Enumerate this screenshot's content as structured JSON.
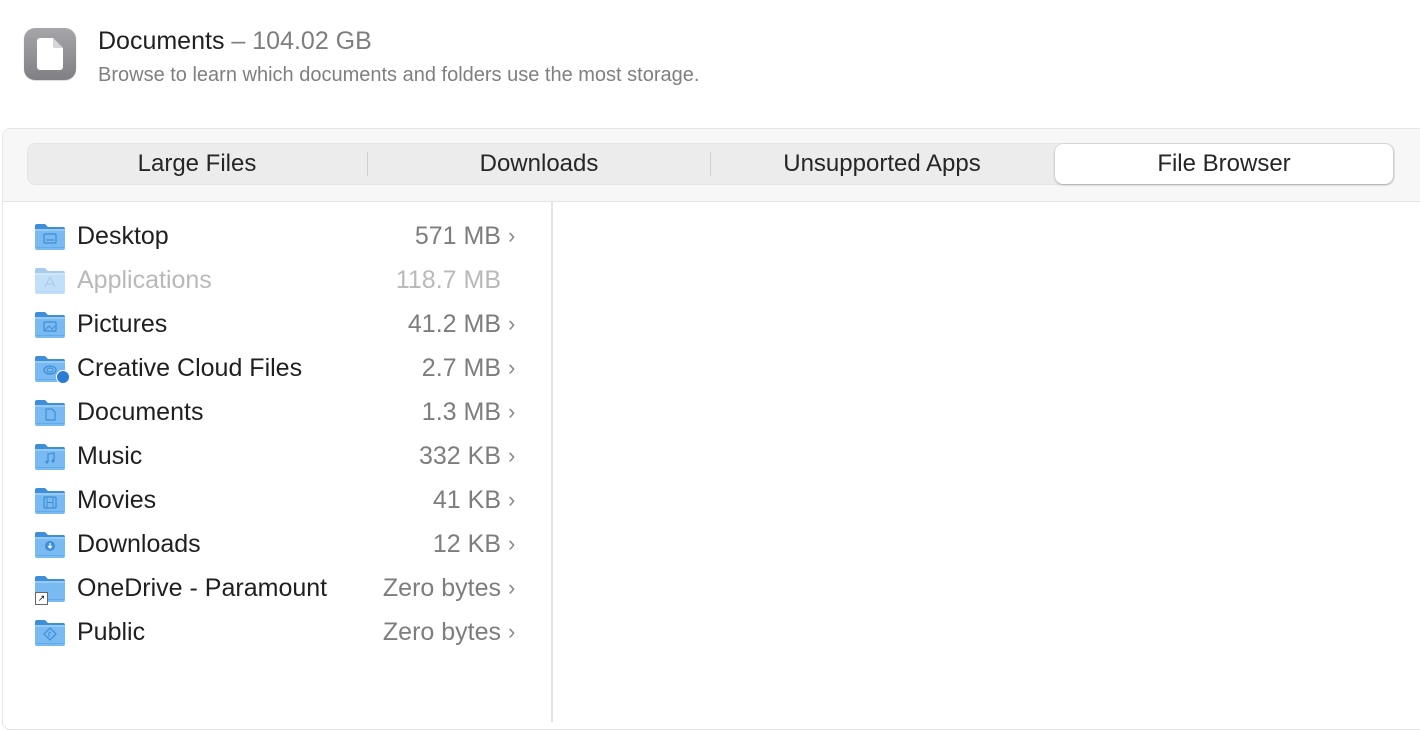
{
  "header": {
    "icon": "document-icon",
    "title": "Documents",
    "separator": "–",
    "size": "104.02 GB",
    "subtitle": "Browse to learn which documents and folders use the most storage."
  },
  "tabs": [
    {
      "label": "Large Files",
      "active": false
    },
    {
      "label": "Downloads",
      "active": false
    },
    {
      "label": "Unsupported Apps",
      "active": false
    },
    {
      "label": "File Browser",
      "active": true
    }
  ],
  "folders": [
    {
      "name": "Desktop",
      "size": "571 MB",
      "icon": "desktop-folder-icon",
      "glyph": "desktop",
      "enabled": true,
      "has_chevron": true
    },
    {
      "name": "Applications",
      "size": "118.7 MB",
      "icon": "applications-folder-icon",
      "glyph": "apps",
      "enabled": false,
      "has_chevron": false
    },
    {
      "name": "Pictures",
      "size": "41.2 MB",
      "icon": "pictures-folder-icon",
      "glyph": "pictures",
      "enabled": true,
      "has_chevron": true
    },
    {
      "name": "Creative Cloud Files",
      "size": "2.7 MB",
      "icon": "creative-cloud-folder-icon",
      "glyph": "cc",
      "enabled": true,
      "has_chevron": true,
      "badge": "sync-paused-badge"
    },
    {
      "name": "Documents",
      "size": "1.3 MB",
      "icon": "documents-folder-icon",
      "glyph": "document",
      "enabled": true,
      "has_chevron": true
    },
    {
      "name": "Music",
      "size": "332 KB",
      "icon": "music-folder-icon",
      "glyph": "music",
      "enabled": true,
      "has_chevron": true
    },
    {
      "name": "Movies",
      "size": "41 KB",
      "icon": "movies-folder-icon",
      "glyph": "movies",
      "enabled": true,
      "has_chevron": true
    },
    {
      "name": "Downloads",
      "size": "12 KB",
      "icon": "downloads-folder-icon",
      "glyph": "download",
      "enabled": true,
      "has_chevron": true
    },
    {
      "name": "OneDrive - Paramount",
      "size": "Zero bytes",
      "icon": "onedrive-folder-icon",
      "glyph": "none",
      "enabled": true,
      "has_chevron": true,
      "badge": "alias-arrow-badge"
    },
    {
      "name": "Public",
      "size": "Zero bytes",
      "icon": "public-folder-icon",
      "glyph": "public",
      "enabled": true,
      "has_chevron": true
    }
  ],
  "chevron": "›"
}
